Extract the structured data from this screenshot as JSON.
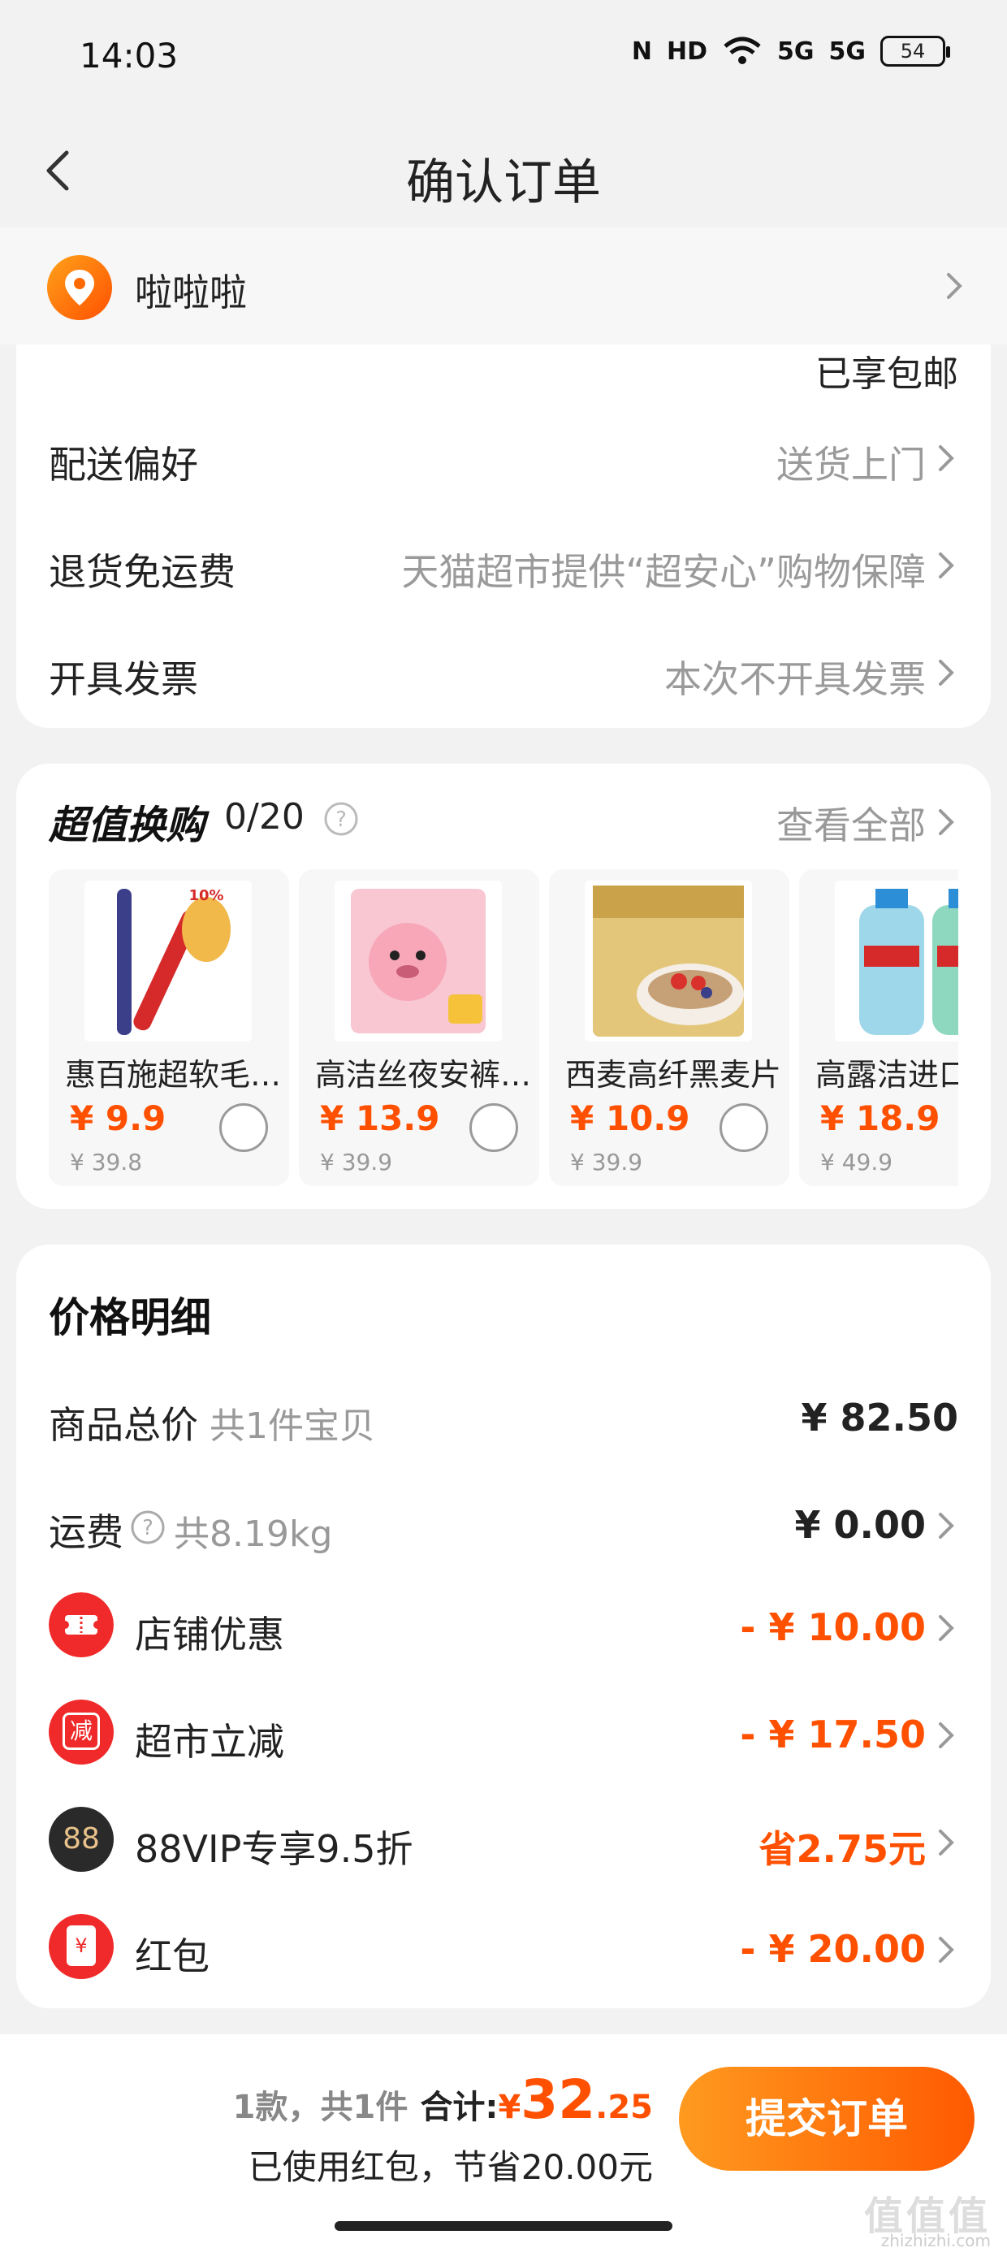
{
  "status_bar": {
    "time": "14:03",
    "battery": "54",
    "signal_1": "5G",
    "signal_2": "5G",
    "hd": "HD"
  },
  "nav": {
    "title": "确认订单"
  },
  "address": {
    "name": "啦啦啦"
  },
  "delivery": {
    "shipping_note": "已享包邮",
    "rows": [
      {
        "label": "配送偏好",
        "value": "送货上门"
      },
      {
        "label": "退货免运费",
        "value": "天猫超市提供“超安心”购物保障"
      },
      {
        "label": "开具发票",
        "value": "本次不开具发票"
      }
    ]
  },
  "swap": {
    "title": "超值换购",
    "count": "0/20",
    "view_all": "查看全部",
    "products": [
      {
        "name": "惠百施超软毛牙刷",
        "price": "¥ 9.9",
        "orig": "¥ 39.8",
        "img_color": "#e8e2e2",
        "accent": "#d62a2a"
      },
      {
        "name": "高洁丝夜安裤…",
        "price": "¥ 13.9",
        "orig": "¥ 39.9",
        "img_color": "#f7c6cf",
        "accent": "#ef8aa0"
      },
      {
        "name": "西麦高纤黑麦片",
        "price": "¥ 10.9",
        "orig": "¥ 39.9",
        "img_color": "#e4c67a",
        "accent": "#8a5b2b"
      },
      {
        "name": "高露洁进口漱口水",
        "price": "¥ 18.9",
        "orig": "¥ 49.9",
        "img_color": "#cdeef6",
        "accent": "#2b8ed6"
      }
    ]
  },
  "price": {
    "title": "价格明细",
    "subtotal": {
      "label": "商品总价",
      "sub": "共1件宝贝",
      "value": "¥ 82.50"
    },
    "shipping": {
      "label": "运费",
      "sub": "共8.19kg",
      "value": "¥ 0.00"
    },
    "discounts": [
      {
        "label": "店铺优惠",
        "value": "- ¥ 10.00",
        "icon": "ticket-icon",
        "icon_text": ""
      },
      {
        "label": "超市立减",
        "value": "- ¥ 17.50",
        "icon": "reduce-icon",
        "icon_text": "减"
      },
      {
        "label": "88VIP专享9.5折",
        "value": "省2.75元",
        "icon": "vip88-icon",
        "icon_text": "88"
      },
      {
        "label": "红包",
        "value": "- ¥ 20.00",
        "icon": "red-packet-icon",
        "icon_text": "¥"
      }
    ]
  },
  "footer": {
    "count": "1款，共1件",
    "total_label": "合计:",
    "currency": "¥",
    "total_int": "32",
    "total_dec": ".25",
    "saving_note": "已使用红包，节省20.00元",
    "submit": "提交订单",
    "watermark": "值值值",
    "watermark_sub": "zhizhizhi.com"
  },
  "colors": {
    "accent": "#ff5000",
    "red": "#f02a2a",
    "muted": "#999999"
  }
}
